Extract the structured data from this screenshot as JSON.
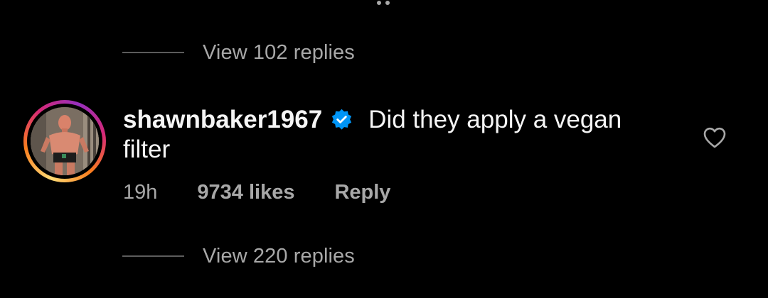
{
  "top_replies": {
    "label": "View 102 replies"
  },
  "comment": {
    "username": "shawnbaker1967",
    "verified": true,
    "text": "Did they apply a vegan filter",
    "time": "19h",
    "likes": "9734 likes",
    "reply_label": "Reply"
  },
  "bottom_replies": {
    "label": "View 220 replies"
  },
  "icons": {
    "verified": "verified-badge-icon",
    "like": "heart-outline-icon"
  },
  "colors": {
    "background": "#000000",
    "primary_text": "#f5f5f5",
    "secondary_text": "#a8a8a8",
    "verified_blue": "#0095f6"
  }
}
